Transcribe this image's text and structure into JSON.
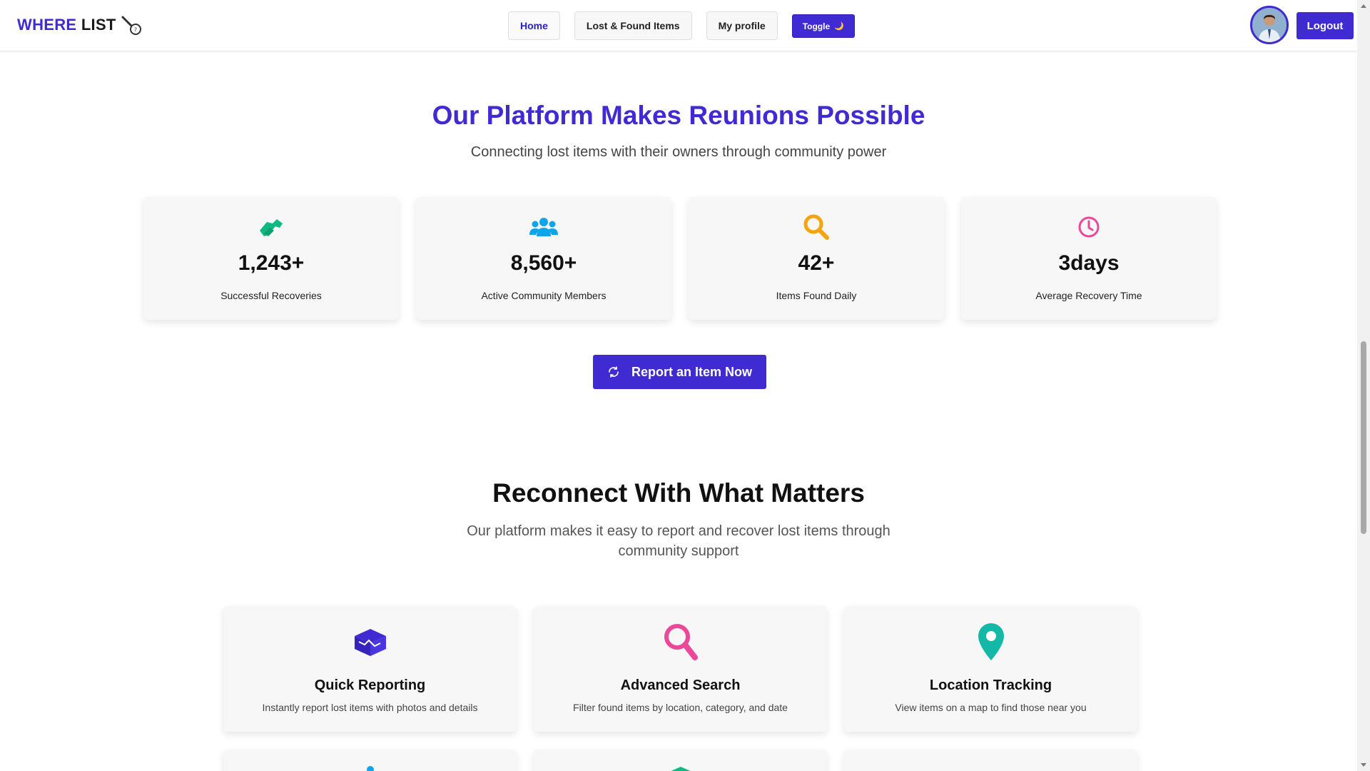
{
  "navbar": {
    "logo_word1": "WHERE",
    "logo_word2": "LIST",
    "links": [
      {
        "label": "Home"
      },
      {
        "label": "Lost & Found Items"
      },
      {
        "label": "My profile"
      }
    ],
    "toggle_label": "Toggle",
    "toggle_icon": "🌙",
    "logout_label": "Logout"
  },
  "hero": {
    "title": "Our Platform Makes Reunions Possible",
    "subtitle": "Connecting lost items with their owners through community power",
    "stats": [
      {
        "icon": "handshake-icon",
        "value": "1,243+",
        "label": "Successful Recoveries",
        "color": "#10b981"
      },
      {
        "icon": "users-icon",
        "value": "8,560+",
        "label": "Active Community Members",
        "color": "#0ea5e9"
      },
      {
        "icon": "search-icon",
        "value": "42+",
        "label": "Items Found Daily",
        "color": "#f59e0b"
      },
      {
        "icon": "clock-icon",
        "value": "3days",
        "label": "Average Recovery Time",
        "color": "#ec4899"
      }
    ],
    "report_button": "Report an Item Now"
  },
  "features": {
    "title": "Reconnect With What Matters",
    "subtitle_line1": "Our platform makes it easy to report and recover lost items through",
    "subtitle_line2": "community support",
    "cards": [
      {
        "icon": "box-icon",
        "title": "Quick Reporting",
        "desc": "Instantly report lost items with photos and details",
        "color": "#3f2bd1"
      },
      {
        "icon": "search-icon",
        "title": "Advanced Search",
        "desc": "Filter found items by location, category, and date",
        "color": "#ec4899"
      },
      {
        "icon": "map-pin-icon",
        "title": "Location Tracking",
        "desc": "View items on a map to find those near you",
        "color": "#14b8a6"
      }
    ]
  },
  "colors": {
    "brand": "#3f2bd1"
  }
}
